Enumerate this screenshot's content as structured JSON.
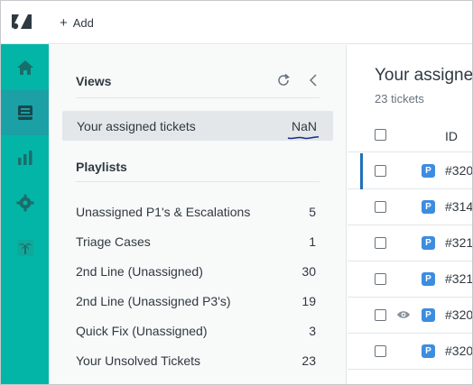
{
  "topbar": {
    "add_label": "Add"
  },
  "rail": {
    "items": [
      "home-icon",
      "views-icon",
      "reporting-icon",
      "admin-icon",
      "palm-tree-icon"
    ],
    "accent_color": "#03b5a7"
  },
  "views": {
    "title": "Views",
    "selected": {
      "label": "Your assigned tickets",
      "count": "NaN"
    },
    "playlists_title": "Playlists",
    "playlists": [
      {
        "label": "Unassigned P1's & Escalations",
        "count": "5"
      },
      {
        "label": "Triage Cases",
        "count": "1"
      },
      {
        "label": "2nd Line (Unassigned)",
        "count": "30"
      },
      {
        "label": "2nd Line (Unassigned P3's)",
        "count": "19"
      },
      {
        "label": "Quick Fix (Unassigned)",
        "count": "3"
      },
      {
        "label": "Your Unsolved Tickets",
        "count": "23"
      }
    ]
  },
  "tickets": {
    "title": "Your assigned tickets",
    "subtitle": "23 tickets",
    "column_id": "ID",
    "rows": [
      {
        "priority": "P",
        "id": "#320"
      },
      {
        "priority": "P",
        "id": "#314"
      },
      {
        "priority": "P",
        "id": "#321"
      },
      {
        "priority": "P",
        "id": "#321"
      },
      {
        "priority": "P",
        "id": "#320"
      },
      {
        "priority": "P",
        "id": "#320"
      }
    ]
  }
}
